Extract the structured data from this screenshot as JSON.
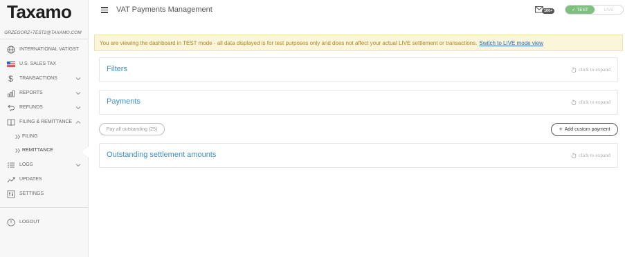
{
  "brand": {
    "logo_text": "Taxamo"
  },
  "user": {
    "email": "GRZEGORZ+TEST2@TAXAMO.COM"
  },
  "sidebar": {
    "items": [
      {
        "label": "INTERNATIONAL VAT/GST",
        "icon": "globe-icon"
      },
      {
        "label": "U.S. SALES TAX",
        "icon": "us-flag-icon"
      },
      {
        "label": "TRANSACTIONS",
        "icon": "dollar-icon"
      },
      {
        "label": "REPORTS",
        "icon": "bar-chart-icon"
      },
      {
        "label": "REFUNDS",
        "icon": "refund-arrow-icon"
      },
      {
        "label": "FILING & REMITTANCE",
        "icon": "book-icon"
      },
      {
        "label": "FILING",
        "icon": "double-chevron-icon"
      },
      {
        "label": "REMITTANCE",
        "icon": "double-chevron-icon"
      },
      {
        "label": "LOGS",
        "icon": "list-icon"
      },
      {
        "label": "UPDATES",
        "icon": "trend-icon"
      },
      {
        "label": "SETTINGS",
        "icon": "sliders-icon"
      }
    ],
    "logout_label": "LOGOUT"
  },
  "header": {
    "title": "VAT Payments Management",
    "notification_count": "100+",
    "mode_test_label": "✓ TEST",
    "mode_live_label": "LIVE"
  },
  "banner": {
    "text": "You are viewing the dashboard in TEST mode - all data displayed is for test purposes only and does not affect your actual LIVE settlement or transactions.",
    "link_text": "Switch to LIVE mode view"
  },
  "panels": {
    "filters": {
      "title": "Filters",
      "expand_hint": "click to expand"
    },
    "payments": {
      "title": "Payments",
      "expand_hint": "click to expand"
    },
    "outstanding": {
      "title": "Outstanding settlement amounts",
      "expand_hint": "click to expand"
    }
  },
  "actions": {
    "pay_all_label": "Pay all outstanding (25)",
    "add_custom_label": "Add custom payment"
  },
  "colors": {
    "accent": "#3a8fc8",
    "test_mode": "#7fbf7f",
    "banner_bg": "#fbf5d9",
    "banner_text": "#b0842a",
    "link": "#2a6db8"
  }
}
